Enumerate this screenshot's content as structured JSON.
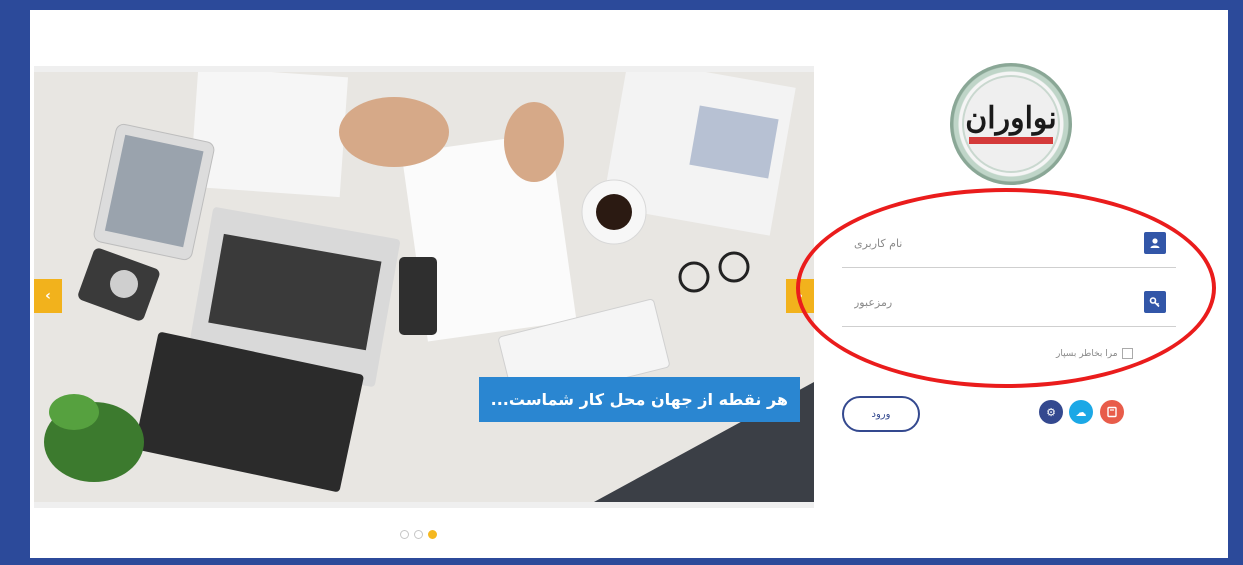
{
  "slider": {
    "caption": "هر نقطه از جهان محل کار شماست...",
    "prev_icon": "‹",
    "next_icon": "›",
    "dots": [
      false,
      false,
      true
    ]
  },
  "logo": {
    "text": "نواوران"
  },
  "login": {
    "username_placeholder": "نام کاربری",
    "password_placeholder": "رمزعبور",
    "remember_label": "مرا بخاطر بسپار",
    "submit_label": "ورود",
    "user_icon": "user-icon",
    "key_icon": "key-icon"
  },
  "actions": {
    "settings_icon": "gear-icon",
    "cloud_icon": "cloud-download-icon",
    "book_icon": "book-icon"
  },
  "colors": {
    "accent": "#3256a8",
    "slider_arrow": "#f2b21c",
    "caption_bg": "#2a86d1",
    "annotation": "#ea1c1c"
  }
}
